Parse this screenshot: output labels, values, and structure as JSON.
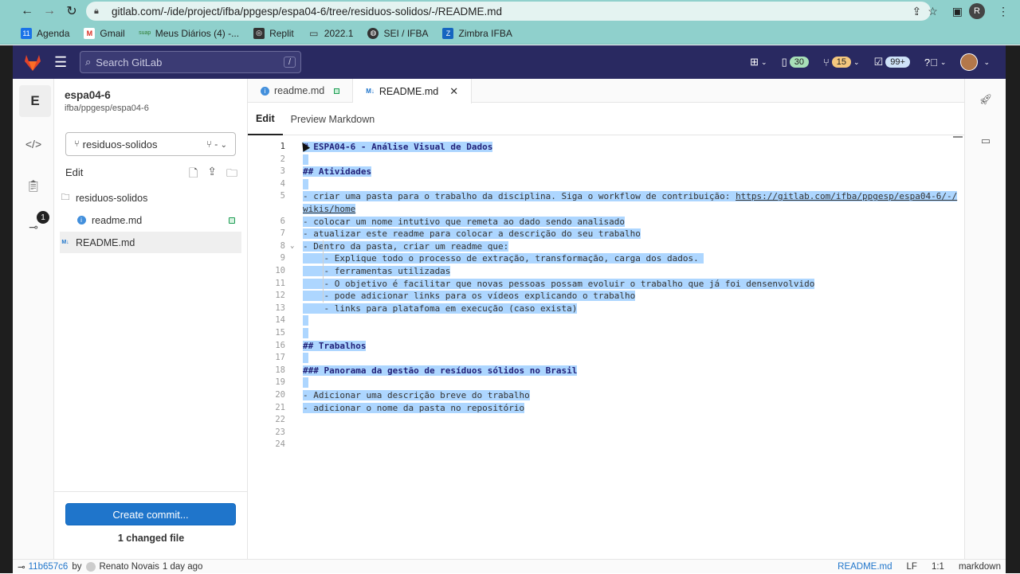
{
  "browser": {
    "url": "gitlab.com/-/ide/project/ifba/ppgesp/espa04-6/tree/residuos-solidos/-/README.md",
    "profile_initial": "R",
    "bookmarks": [
      {
        "label": "Agenda",
        "icon": "calendar-icon",
        "color": "#1a73e8"
      },
      {
        "label": "Gmail",
        "icon": "gmail-icon",
        "color": "#d93025"
      },
      {
        "label": "Meus Diários (4) -...",
        "icon": "suap-icon",
        "color": "#2e7d32"
      },
      {
        "label": "Replit",
        "icon": "replit-icon",
        "color": "#333333"
      },
      {
        "label": "2022.1",
        "icon": "folder-icon",
        "color": "#444444"
      },
      {
        "label": "SEI / IFBA",
        "icon": "globe-icon",
        "color": "#333333"
      },
      {
        "label": "Zimbra IFBA",
        "icon": "zimbra-icon",
        "color": "#1565c0"
      }
    ]
  },
  "header": {
    "search_placeholder": "Search GitLab",
    "search_shortcut": "/",
    "issues_count": "30",
    "mr_count": "15",
    "todos_count": "99+",
    "colors": {
      "bg": "#292961",
      "issues_badge": "#a8e0b8",
      "mr_badge": "#f5c77e",
      "todos_badge": "#cfe2f8"
    }
  },
  "project": {
    "avatar_letter": "E",
    "name": "espa04-6",
    "path": "ifba/ppgesp/espa04-6",
    "branch": "residuos-solidos",
    "branch_suffix": "-",
    "rail_badge": "1"
  },
  "tree": {
    "edit_label": "Edit",
    "items": [
      {
        "label": "residuos-solidos",
        "icon": "folder-icon"
      },
      {
        "label": "readme.md",
        "icon": "info-icon"
      },
      {
        "label": "README.md",
        "icon": "markdown-icon"
      }
    ],
    "commit_button": "Create commit...",
    "changed_files": "1 changed file"
  },
  "editor": {
    "tabs": [
      {
        "label": "readme.md",
        "icon": "info-icon"
      },
      {
        "label": "README.md",
        "icon": "markdown-icon"
      }
    ],
    "mode_tabs": [
      "Edit",
      "Preview Markdown"
    ],
    "lines": [
      {
        "n": "1",
        "text": "# ESPA04-6 - Análise Visual de Dados",
        "kind": "h"
      },
      {
        "n": "2",
        "text": "",
        "kind": "blank"
      },
      {
        "n": "3",
        "text": "## Atividades",
        "kind": "h"
      },
      {
        "n": "4",
        "text": "",
        "kind": "blank"
      },
      {
        "n": "5",
        "text": "- criar uma pasta para o trabalho da disciplina. Siga o workflow de contribuição: ",
        "kind": "t",
        "link": "https://gitlab.com/ifba/ppgesp/espa04-6/-/",
        "link2": "wikis/home"
      },
      {
        "n": "6",
        "text": "- colocar um nome intutivo que remeta ao dado sendo analisado",
        "kind": "t"
      },
      {
        "n": "7",
        "text": "- atualizar este readme para colocar a descrição do seu trabalho",
        "kind": "t"
      },
      {
        "n": "8",
        "text": "- Dentro da pasta, criar um readme que:",
        "kind": "t"
      },
      {
        "n": "9",
        "text": "    - Explique todo o processo de extração, transformação, carga dos dados. ",
        "kind": "t"
      },
      {
        "n": "10",
        "text": "    - ferramentas utilizadas",
        "kind": "t"
      },
      {
        "n": "11",
        "text": "    - O objetivo é facilitar que novas pessoas possam evoluir o trabalho que já foi densenvolvido",
        "kind": "t"
      },
      {
        "n": "12",
        "text": "    - pode adicionar links para os vídeos explicando o trabalho",
        "kind": "t"
      },
      {
        "n": "13",
        "text": "    - links para platafoma em execução (caso exista)",
        "kind": "t"
      },
      {
        "n": "14",
        "text": "",
        "kind": "blank"
      },
      {
        "n": "15",
        "text": "",
        "kind": "blank"
      },
      {
        "n": "16",
        "text": "## Trabalhos",
        "kind": "h"
      },
      {
        "n": "17",
        "text": "",
        "kind": "blank"
      },
      {
        "n": "18",
        "text": "### Panorama da gestão de resíduos sólidos no Brasil",
        "kind": "h"
      },
      {
        "n": "19",
        "text": "",
        "kind": "blank"
      },
      {
        "n": "20",
        "text": "- Adicionar uma descrição breve do trabalho",
        "kind": "t"
      },
      {
        "n": "21",
        "text": "- adicionar o nome da pasta no repositório",
        "kind": "t"
      },
      {
        "n": "22",
        "text": "",
        "kind": "end"
      },
      {
        "n": "23",
        "text": "",
        "kind": "end"
      },
      {
        "n": "24",
        "text": "",
        "kind": "end"
      }
    ]
  },
  "status": {
    "sha": "11b657c6",
    "by": "by",
    "author": "Renato Novais",
    "when": "1 day ago",
    "filename": "README.md",
    "eol": "LF",
    "position": "1:1",
    "language": "markdown"
  }
}
